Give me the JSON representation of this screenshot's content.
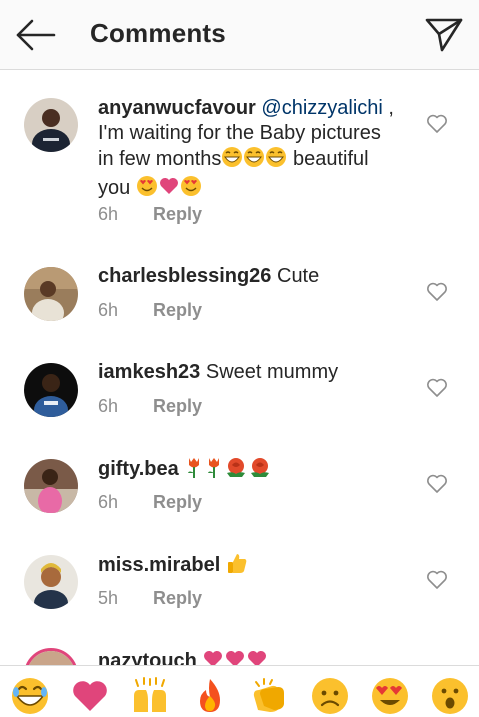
{
  "header": {
    "title": "Comments"
  },
  "comments": [
    {
      "username": "anyanwucfavour",
      "mention": "@chizzyalichi",
      "text_1": " ,",
      "text_2": "I'm waiting for the Baby pictures",
      "text_3": "in few months",
      "text_4": " beautiful",
      "text_5": "you",
      "time": "6h",
      "reply": "Reply"
    },
    {
      "username": "charlesblessing26",
      "text": " Cute",
      "time": "6h",
      "reply": "Reply"
    },
    {
      "username": "iamkesh23",
      "text": " Sweet mummy",
      "time": "6h",
      "reply": "Reply"
    },
    {
      "username": "gifty.bea",
      "time": "6h",
      "reply": "Reply"
    },
    {
      "username": "miss.mirabel",
      "time": "5h",
      "reply": "Reply"
    },
    {
      "username": "nazytouch"
    }
  ],
  "emoji_bar": [
    "grinning-face-icon",
    "heart-icon",
    "raising-hands-icon",
    "fire-icon",
    "clapping-hands-icon",
    "sad-face-icon",
    "heart-eyes-icon",
    "surprised-face-icon"
  ],
  "colors": {
    "accent_link": "#003569",
    "muted": "#8e8e8e",
    "heart": "#e0457b",
    "emoji_yellow": "#fbc02d"
  }
}
